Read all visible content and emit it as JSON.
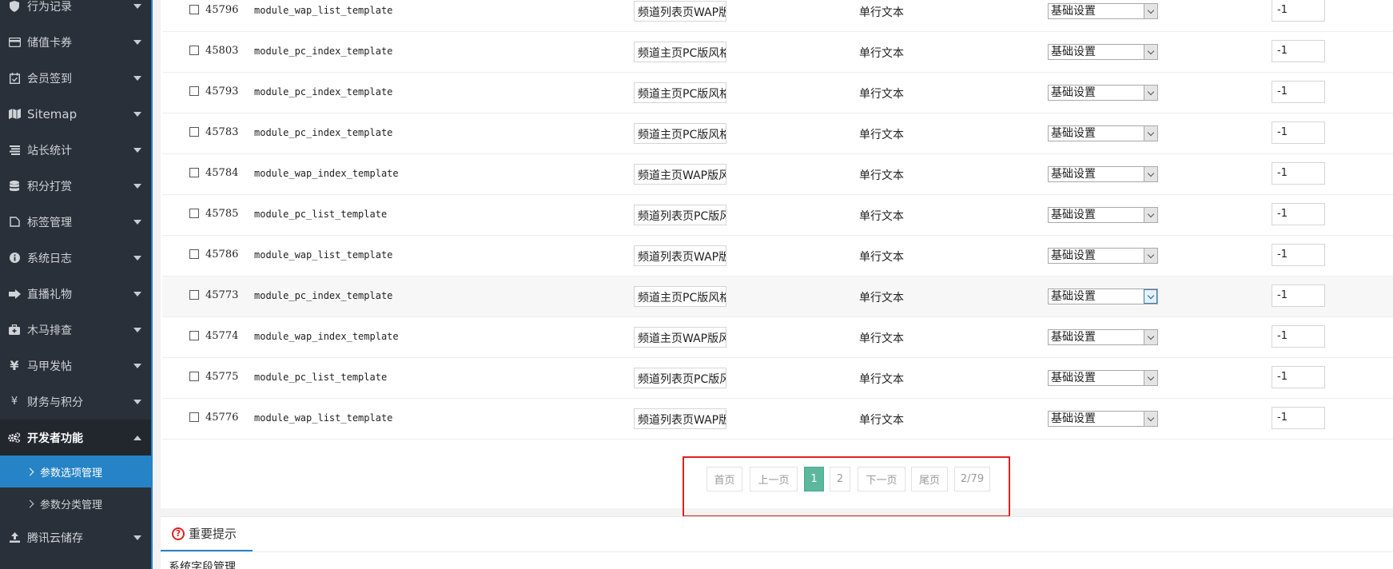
{
  "sidebar": {
    "items": [
      {
        "label": "行为记录",
        "icon": "shield-icon"
      },
      {
        "label": "储值卡券",
        "icon": "credit-card-icon"
      },
      {
        "label": "会员签到",
        "icon": "calendar-check-icon"
      },
      {
        "label": "Sitemap",
        "icon": "map-icon"
      },
      {
        "label": "站长统计",
        "icon": "list-icon"
      },
      {
        "label": "积分打赏",
        "icon": "database-icon"
      },
      {
        "label": "标签管理",
        "icon": "tag-icon"
      },
      {
        "label": "系统日志",
        "icon": "info-icon"
      },
      {
        "label": "直播礼物",
        "icon": "gift-icon"
      },
      {
        "label": "木马排查",
        "icon": "medkit-icon"
      },
      {
        "label": "马甲发帖",
        "icon": "yen-icon"
      },
      {
        "label": "财务与积分",
        "icon": "yen-small-icon"
      },
      {
        "label": "开发者功能",
        "icon": "cogs-icon"
      }
    ],
    "subitems": [
      {
        "label": "参数选项管理",
        "active": true
      },
      {
        "label": "参数分类管理",
        "active": false
      }
    ],
    "after": {
      "label": "腾讯云储存",
      "icon": "upload-icon"
    }
  },
  "table": {
    "rows": [
      {
        "id": "45796",
        "name": "module_wap_list_template",
        "title": "频道列表页WAP版风格",
        "type": "单行文本",
        "group": "基础设置",
        "order": "-1"
      },
      {
        "id": "45803",
        "name": "module_pc_index_template",
        "title": "频道主页PC版风格",
        "type": "单行文本",
        "group": "基础设置",
        "order": "-1"
      },
      {
        "id": "45793",
        "name": "module_pc_index_template",
        "title": "频道主页PC版风格",
        "type": "单行文本",
        "group": "基础设置",
        "order": "-1"
      },
      {
        "id": "45783",
        "name": "module_pc_index_template",
        "title": "频道主页PC版风格",
        "type": "单行文本",
        "group": "基础设置",
        "order": "-1"
      },
      {
        "id": "45784",
        "name": "module_wap_index_template",
        "title": "频道主页WAP版风格",
        "type": "单行文本",
        "group": "基础设置",
        "order": "-1"
      },
      {
        "id": "45785",
        "name": "module_pc_list_template",
        "title": "频道列表页PC版风格",
        "type": "单行文本",
        "group": "基础设置",
        "order": "-1"
      },
      {
        "id": "45786",
        "name": "module_wap_list_template",
        "title": "频道列表页WAP版风格",
        "type": "单行文本",
        "group": "基础设置",
        "order": "-1"
      },
      {
        "id": "45773",
        "name": "module_pc_index_template",
        "title": "频道主页PC版风格",
        "type": "单行文本",
        "group": "基础设置",
        "order": "-1",
        "highlight": true
      },
      {
        "id": "45774",
        "name": "module_wap_index_template",
        "title": "频道主页WAP版风格",
        "type": "单行文本",
        "group": "基础设置",
        "order": "-1"
      },
      {
        "id": "45775",
        "name": "module_pc_list_template",
        "title": "频道列表页PC版风格",
        "type": "单行文本",
        "group": "基础设置",
        "order": "-1"
      },
      {
        "id": "45776",
        "name": "module_wap_list_template",
        "title": "频道列表页WAP版风格",
        "type": "单行文本",
        "group": "基础设置",
        "order": "-1"
      }
    ]
  },
  "pagination": {
    "first": "首页",
    "prev": "上一页",
    "pages": [
      "1",
      "2"
    ],
    "current": "1",
    "next": "下一页",
    "last": "尾页",
    "info": "2/79"
  },
  "tips": {
    "tab_label": "重要提示",
    "body": "系统字段管理"
  },
  "colors": {
    "sidebar_bg": "#2a3039",
    "accent": "#2683c6",
    "current_page": "#5bb89c",
    "highlight_box": "#e02020"
  }
}
